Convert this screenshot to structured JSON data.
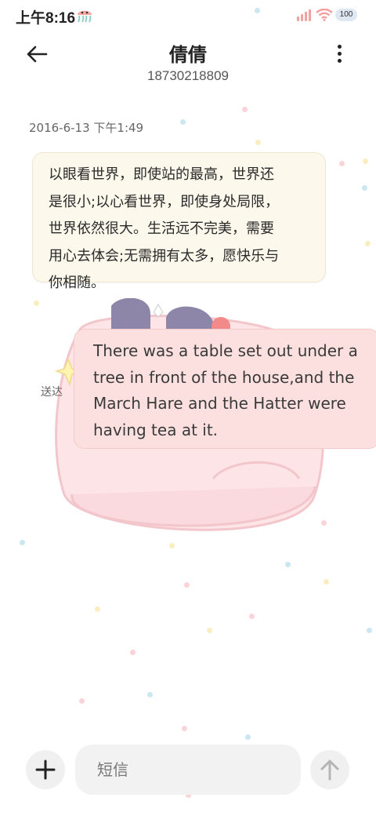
{
  "status_bar": {
    "time": "上午8:16",
    "battery": "100"
  },
  "header": {
    "contact_name": "倩倩",
    "phone_number": "18730218809"
  },
  "conversation": {
    "timestamp": "2016-6-13 下午1:49",
    "messages": [
      {
        "direction": "incoming",
        "lines": [
          "以眼看世界，即使站的最高，世界还",
          "是很小;以心看世界，即使身处局限，",
          "世界依然很大。生活远不完美，需要",
          "用心去体会;无需拥有太多，愿快乐与",
          "你相随。"
        ]
      },
      {
        "direction": "outgoing",
        "lines": [
          "There was a table set out under a",
          "tree in front of the house,and the",
          "March Hare and the Hatter were",
          "having tea at it."
        ],
        "status": "送达"
      }
    ]
  },
  "composer": {
    "placeholder": "短信"
  },
  "icons": {
    "back": "arrow-left-icon",
    "menu": "more-vertical-icon",
    "add": "plus-icon",
    "send": "arrow-up-icon",
    "status": "jellyfish-icon"
  },
  "colors": {
    "incoming_bubble": "#fdf8ec",
    "outgoing_bubble": "#fce0e0",
    "composer_bg": "#f2f2f2",
    "cloud": "#fbe3e6"
  }
}
